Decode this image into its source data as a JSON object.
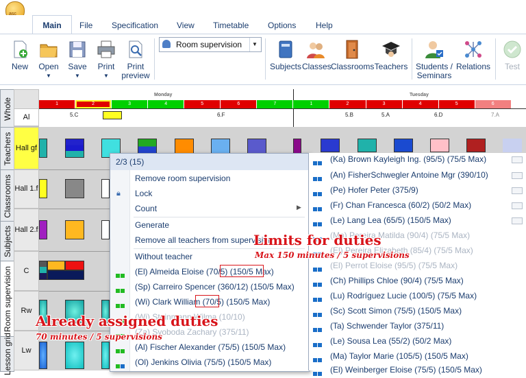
{
  "app": {
    "logo_text": "asc"
  },
  "menu": {
    "tabs": [
      "Main",
      "File",
      "Specification",
      "View",
      "Timetable",
      "Options",
      "Help"
    ]
  },
  "ribbon": {
    "new": "New",
    "open": "Open",
    "save": "Save",
    "print": "Print",
    "print_preview_1": "Print",
    "print_preview_2": "preview",
    "view_select_value": "Room supervision",
    "subjects": "Subjects",
    "classes": "Classes",
    "classrooms": "Classrooms",
    "teachers": "Teachers",
    "students_1": "Students /",
    "students_2": "Seminars",
    "relations": "Relations",
    "test": "Test"
  },
  "side_tabs": [
    "Whole",
    "Teachers",
    "Classrooms",
    "Subjects",
    "Room supervision",
    "Lesson grid"
  ],
  "grid": {
    "days": [
      "Monday",
      "Tuesday"
    ],
    "period_numbers": [
      "1",
      "2",
      "3",
      "4",
      "5",
      "6",
      "7",
      "1",
      "2",
      "3",
      "4",
      "5",
      "6"
    ],
    "period_colors": [
      "#e00000",
      "#e00000",
      "#00d000",
      "#00d000",
      "#e00000",
      "#e00000",
      "#00d000",
      "#00d000",
      "#e00000",
      "#e00000",
      "#e00000",
      "#e00000",
      "#f28080"
    ],
    "all_row_label": "Al",
    "all_row_classes": [
      "5.C",
      "6.F",
      "5.B",
      "5.A",
      "6.D",
      "7.A"
    ],
    "rows": [
      "Hall gf",
      "Hall 1.f",
      "Hall 2.f",
      "C",
      "Rw",
      "Lw"
    ]
  },
  "context_menu": {
    "title": "2/3 (15)",
    "items": [
      "Remove room supervision",
      "Lock",
      "Count",
      "Generate",
      "Remove all teachers from supervision",
      "Without teacher"
    ],
    "teachers": [
      "(El) Almeida Eloise (70/5) (150/5 Max)",
      "(Sp) Carreiro Spencer (360/12) (150/5 Max)",
      "(Wi) Clark William (70/5) (150/5 Max)",
      "(Wi) Steinmann Wilma (10/10)",
      "(Za) Svoboda Zachary (375/11)",
      "(Al) Fischer Alexander (75/5) (150/5 Max)",
      "(Ol) Jenkins Olivia (75/5) (150/5 Max)"
    ]
  },
  "teacher_list": [
    "(Ka) Brown Kayleigh Ing. (95/5) (75/5 Max)",
    "(An) FisherSchwegler Antoine Mgr (390/10)",
    "(Pe) Hofer Peter (375/9)",
    "(Fr) Chan Francesca (60/2) (50/2 Max)",
    "(Le) Lang Lea (65/5) (150/5 Max)",
    "(Ma) Pereira Matilda (90/4) (75/5 Max)",
    "(El) Pereira Elizabeth (85/4) (75/5 Max)",
    "(El) Perrot Eloise (95/5) (75/5 Max)",
    "(Ch) Phillips Chloe (90/4) (75/5 Max)",
    "(Lu) Rodríguez Lucie (100/5) (75/5 Max)",
    "(Sc) Scott Simon (75/5) (150/5 Max)",
    "(Ta) Schwender Taylor (375/11)",
    "(Le) Sousa Lea (55/2) (50/2 Max)",
    "(Ma) Taylor Marie (105/5) (150/5 Max)",
    "(El) Weinberger Eloise (75/5) (150/5 Max)"
  ],
  "annotations": {
    "limits_title": "Limits for duties",
    "limits_sub": "Max 150 minutes / 5 supervisions",
    "assigned_title": "Already assigned duties",
    "assigned_sub": "70 minutes / 5 supervisions"
  },
  "colors": {
    "accent": "#1a3c6e",
    "annotation_red": "#d8141a",
    "hall_gf_highlight": "#ffff44"
  }
}
